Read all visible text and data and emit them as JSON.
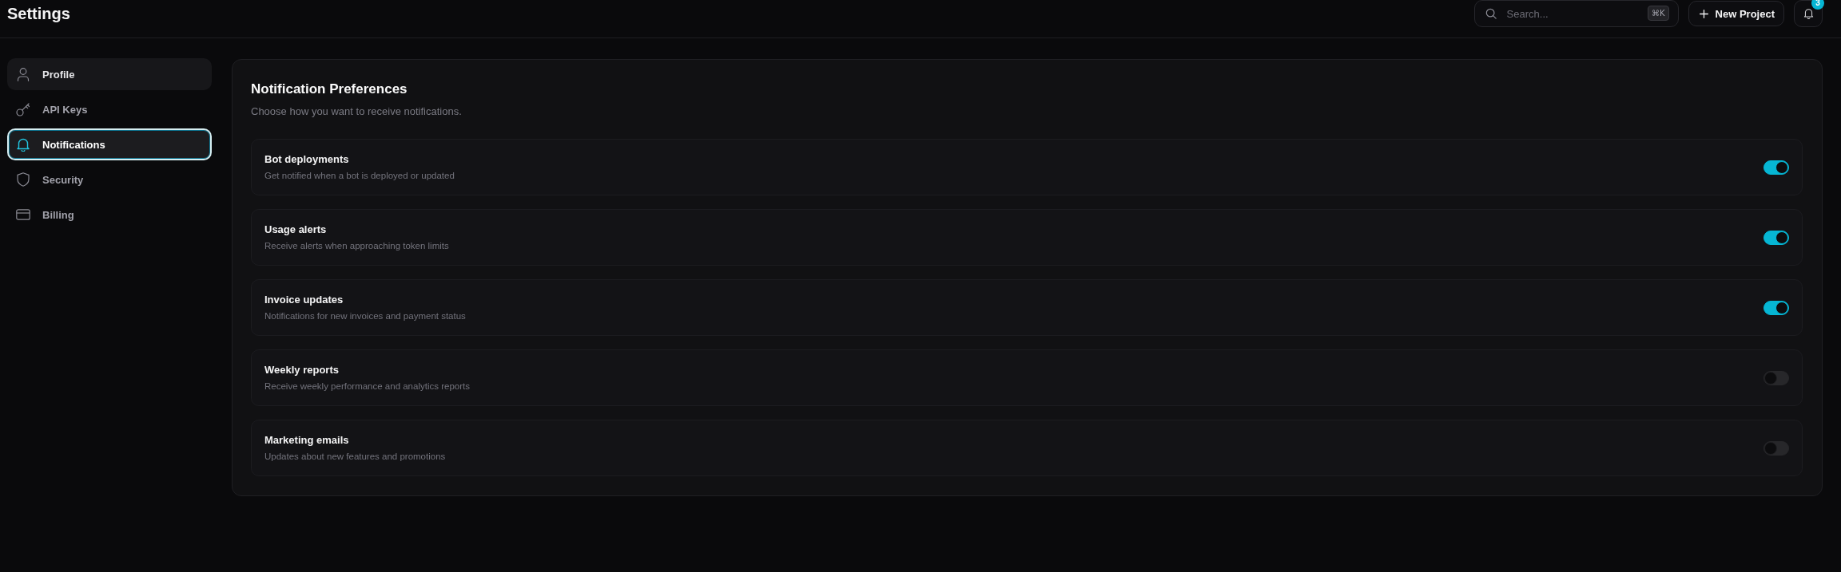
{
  "header": {
    "title": "Settings",
    "search": {
      "placeholder": "Search...",
      "shortcut": "⌘K"
    },
    "new_project_button": "New Project",
    "notifications": {
      "badge": "3"
    }
  },
  "sidebar": {
    "items": [
      {
        "label": "Profile",
        "selected": false,
        "hovered": true
      },
      {
        "label": "API Keys",
        "selected": false,
        "hovered": false
      },
      {
        "label": "Notifications",
        "selected": true,
        "hovered": false
      },
      {
        "label": "Security",
        "selected": false,
        "hovered": false
      },
      {
        "label": "Billing",
        "selected": false,
        "hovered": false
      }
    ]
  },
  "preferences": {
    "title": "Notification Preferences",
    "subtitle": "Choose how you want to receive notifications.",
    "items": [
      {
        "title": "Bot deployments",
        "description": "Get notified when a bot is deployed or updated",
        "on": true
      },
      {
        "title": "Usage alerts",
        "description": "Receive alerts when approaching token limits",
        "on": true
      },
      {
        "title": "Invoice updates",
        "description": "Notifications for new invoices and payment status",
        "on": true
      },
      {
        "title": "Weekly reports",
        "description": "Receive weekly performance and analytics reports",
        "on": false
      },
      {
        "title": "Marketing emails",
        "description": "Updates about new features and promotions",
        "on": false
      }
    ]
  }
}
